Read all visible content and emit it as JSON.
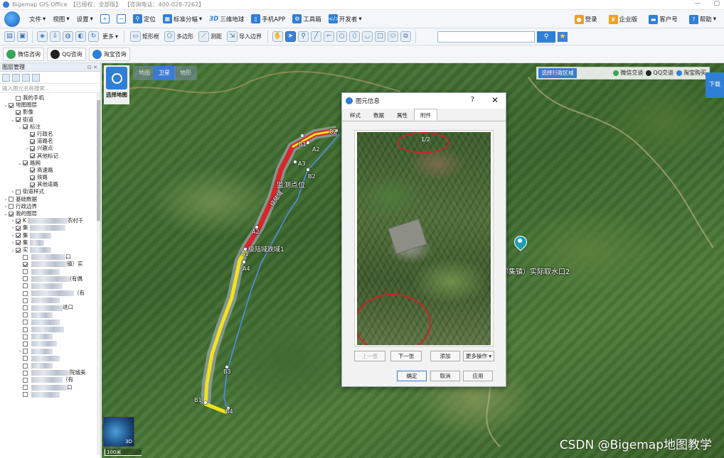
{
  "title": {
    "app": "Bigemap GIS Office",
    "license": "【已授权：全部版】",
    "phone": "【咨询电话：400-028-7262】"
  },
  "menu": {
    "items": [
      "文件",
      "视图",
      "设置",
      "定位",
      "标准分幅",
      "三维地球",
      "手机APP",
      "工具箱",
      "开发者"
    ],
    "right": [
      "登录",
      "企业版",
      "客户号",
      "帮助"
    ]
  },
  "toolbar": {
    "more": "更多",
    "rect": "矩形框",
    "polygon": "多边形",
    "measure": "测距",
    "import": "导入边界",
    "search_placeholder": ""
  },
  "plugins": [
    "微信咨询",
    "QQ咨询",
    "淘宝咨询"
  ],
  "layer_panel": {
    "title": "图层管理",
    "filter_placeholder": "输入图元名称搜索...",
    "tree": [
      {
        "label": "我的手机",
        "level": 1,
        "toggle": "",
        "checked": false,
        "blur": 0
      },
      {
        "label": "地图图层",
        "level": 0,
        "toggle": "⌄",
        "checked": true,
        "blur": 0
      },
      {
        "label": "影像",
        "level": 1,
        "toggle": "",
        "checked": true,
        "blur": 0
      },
      {
        "label": "街道",
        "level": 1,
        "toggle": "⌄",
        "checked": true,
        "blur": 0
      },
      {
        "label": "标注",
        "level": 2,
        "toggle": "⌄",
        "checked": true,
        "blur": 0
      },
      {
        "label": "行政名",
        "level": 3,
        "toggle": "",
        "checked": true,
        "blur": 0
      },
      {
        "label": "道路名",
        "level": 3,
        "toggle": "",
        "checked": true,
        "blur": 0
      },
      {
        "label": "兴趣点",
        "level": 3,
        "toggle": "›",
        "checked": true,
        "blur": 0
      },
      {
        "label": "其他标记",
        "level": 3,
        "toggle": "",
        "checked": true,
        "blur": 0
      },
      {
        "label": "路网",
        "level": 2,
        "toggle": "⌄",
        "checked": true,
        "blur": 0
      },
      {
        "label": "高速路",
        "level": 3,
        "toggle": "",
        "checked": true,
        "blur": 0
      },
      {
        "label": "铁路",
        "level": 3,
        "toggle": "",
        "checked": true,
        "blur": 0
      },
      {
        "label": "其他道路",
        "level": 3,
        "toggle": "",
        "checked": true,
        "blur": 0
      },
      {
        "label": "街道样式",
        "level": 1,
        "toggle": "›",
        "checked": false,
        "blur": 0
      },
      {
        "label": "基础数据",
        "level": 0,
        "toggle": "›",
        "checked": false,
        "blur": 0
      },
      {
        "label": "行政边界",
        "level": 0,
        "toggle": "›",
        "checked": false,
        "blur": 0
      },
      {
        "label": "我的图层",
        "level": 0,
        "toggle": "⌄",
        "checked": true,
        "blur": 0
      },
      {
        "label": "K",
        "level": 1,
        "toggle": "›",
        "checked": true,
        "blur": 56,
        "suffix": "农村千"
      },
      {
        "label": "集",
        "level": 1,
        "toggle": "›",
        "checked": true,
        "blur": 50
      },
      {
        "label": "集",
        "level": 1,
        "toggle": "›",
        "checked": true,
        "blur": 30
      },
      {
        "label": "集",
        "level": 1,
        "toggle": "›",
        "checked": true,
        "blur": 20
      },
      {
        "label": "实",
        "level": 1,
        "toggle": "⌄",
        "checked": true,
        "blur": 30
      },
      {
        "label": "",
        "level": 2,
        "toggle": "",
        "checked": false,
        "blur": 48,
        "suffix": "口"
      },
      {
        "label": "",
        "level": 2,
        "toggle": "",
        "checked": true,
        "blur": 50,
        "suffix": "镇）实"
      },
      {
        "label": "",
        "level": 2,
        "toggle": "",
        "checked": false,
        "blur": 40
      },
      {
        "label": "",
        "level": 2,
        "toggle": "",
        "checked": false,
        "blur": 54,
        "suffix": "(有偶"
      },
      {
        "label": "",
        "level": 2,
        "toggle": "",
        "checked": false,
        "blur": 44
      },
      {
        "label": "",
        "level": 2,
        "toggle": "",
        "checked": false,
        "blur": 60,
        "suffix": "（有"
      },
      {
        "label": "",
        "level": 2,
        "toggle": "",
        "checked": false,
        "blur": 40
      },
      {
        "label": "",
        "level": 2,
        "toggle": "",
        "checked": false,
        "blur": 44,
        "suffix": "进口"
      },
      {
        "label": "",
        "level": 2,
        "toggle": "",
        "checked": false,
        "blur": 30
      },
      {
        "label": "",
        "level": 2,
        "toggle": "",
        "checked": false,
        "blur": 40
      },
      {
        "label": "",
        "level": 2,
        "toggle": "",
        "checked": false,
        "blur": 46
      },
      {
        "label": "",
        "level": 2,
        "toggle": "",
        "checked": false,
        "blur": 30
      },
      {
        "label": "",
        "level": 2,
        "toggle": "",
        "checked": false,
        "blur": 36
      },
      {
        "label": "",
        "level": 2,
        "toggle": "›",
        "checked": false,
        "blur": 30
      },
      {
        "label": "",
        "level": 2,
        "toggle": "",
        "checked": false,
        "blur": 40
      },
      {
        "label": "",
        "level": 2,
        "toggle": "",
        "checked": false,
        "blur": 30
      },
      {
        "label": "",
        "level": 2,
        "toggle": "",
        "checked": false,
        "blur": 54,
        "suffix": "院城美"
      },
      {
        "label": "",
        "level": 2,
        "toggle": "",
        "checked": false,
        "blur": 44,
        "suffix": "（有"
      },
      {
        "label": "",
        "level": 2,
        "toggle": "",
        "checked": false,
        "blur": 50,
        "suffix": "口"
      },
      {
        "label": "",
        "level": 2,
        "toggle": "",
        "checked": false,
        "blur": 40
      }
    ]
  },
  "map": {
    "tabs": [
      "地图",
      "卫星",
      "地形"
    ],
    "active_tab": "卫星",
    "select_map": "选择地图",
    "region_btn": "选择行政区域",
    "region_links": [
      "微信交谈",
      "QQ交谈",
      "淘宝购买"
    ],
    "float_btn": "下载",
    "minimap_label": "3D",
    "scale": "100米",
    "labels": {
      "monitor": "监测点位",
      "land": "级陆域",
      "land2": "级陆域跌域1",
      "water": "部集镇）实际取水口2"
    },
    "points": [
      "B2",
      "B1",
      "A2",
      "A3",
      "B2",
      "A2",
      "A1",
      "A4",
      "B3",
      "B1",
      "B4"
    ]
  },
  "dialog": {
    "title": "图元信息",
    "help": "?",
    "close": "✕",
    "tabs": [
      "样式",
      "数据",
      "属性",
      "附件"
    ],
    "active_tab": "附件",
    "photo_counter": "1/2",
    "buttons": {
      "prev": "上一张",
      "next": "下一张",
      "add": "添加",
      "more": "更多操作",
      "ok": "确定",
      "cancel": "取消",
      "apply": "应用"
    }
  },
  "watermark": "CSDN @Bigemap地图教学",
  "colors": {
    "accent": "#2f7fd6",
    "highlight": "#c8262a",
    "route_yellow": "#f2e21c",
    "route_red": "#d8262a",
    "route_blue": "#4f8fe0"
  }
}
